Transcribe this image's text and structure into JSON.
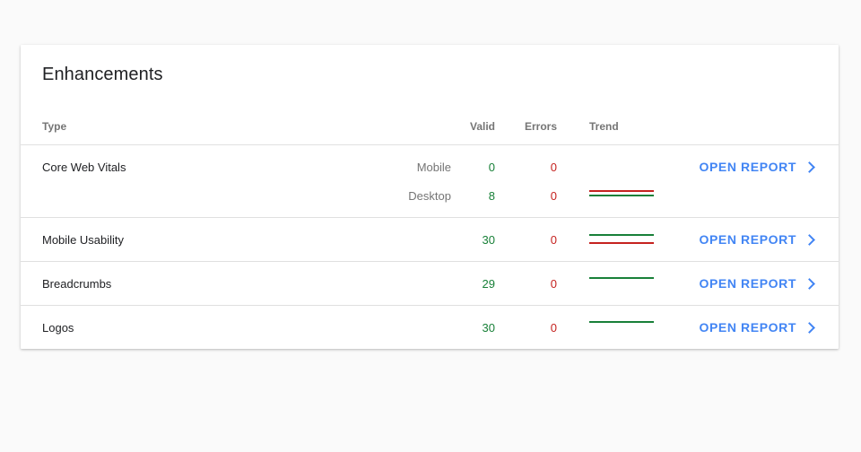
{
  "card": {
    "title": "Enhancements"
  },
  "table": {
    "columns": {
      "type": "Type",
      "valid": "Valid",
      "errors": "Errors",
      "trend": "Trend"
    },
    "open_report_label": "OPEN REPORT",
    "rows": [
      {
        "type": "Core Web Vitals",
        "devices": [
          {
            "device": "Mobile",
            "valid": "0",
            "errors": "0",
            "trend": []
          },
          {
            "device": "Desktop",
            "valid": "8",
            "errors": "0",
            "trend": [
              "#c5221f",
              "#188038"
            ]
          }
        ]
      },
      {
        "type": "Mobile Usability",
        "valid": "30",
        "errors": "0",
        "trend": [
          "#188038",
          "#c5221f"
        ]
      },
      {
        "type": "Breadcrumbs",
        "valid": "29",
        "errors": "0",
        "trend": [
          "#188038"
        ]
      },
      {
        "type": "Logos",
        "valid": "30",
        "errors": "0",
        "trend": [
          "#188038"
        ]
      }
    ]
  },
  "colors": {
    "valid": "#188038",
    "errors": "#c5221f",
    "link": "#4285f4"
  },
  "icons": {
    "open_report": "chevron-right-icon"
  }
}
